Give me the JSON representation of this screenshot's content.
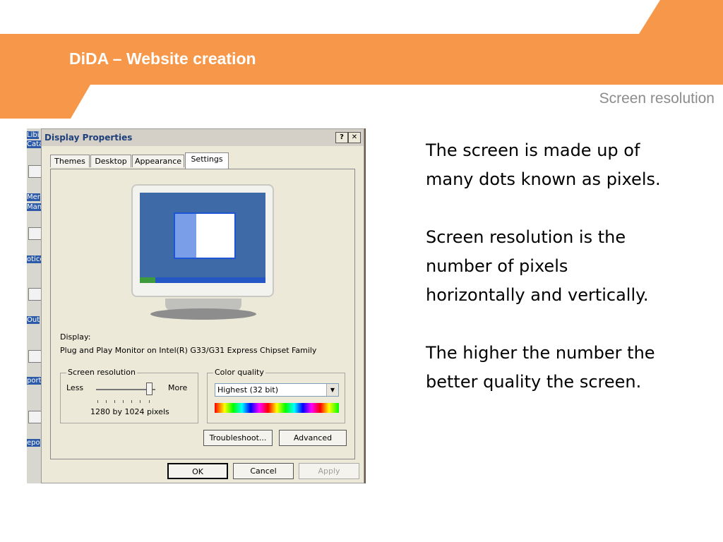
{
  "header": {
    "title": "DiDA – Website creation",
    "subtitle": "Screen resolution",
    "accent_color": "#f7974a"
  },
  "body_text": [
    "The screen is made up of many dots known as pixels.",
    "Screen resolution is the number of pixels horizontally and vertically.",
    "The higher the number the better quality the screen."
  ],
  "desktop": {
    "icon_labels": [
      "Libi",
      "Cata",
      "Mer",
      "Man",
      "otice",
      "Out",
      "port",
      "epo"
    ]
  },
  "dialog": {
    "title": "Display Properties",
    "help_button": "?",
    "close_button": "✕",
    "tabs": [
      "Themes",
      "Desktop",
      "Appearance",
      "Settings"
    ],
    "active_tab": "Settings",
    "display_label": "Display:",
    "display_value": "Plug and Play Monitor on Intel(R) G33/G31 Express Chipset Family",
    "screen_resolution": {
      "legend": "Screen resolution",
      "less_label": "Less",
      "more_label": "More",
      "value_text": "1280 by 1024 pixels"
    },
    "color_quality": {
      "legend": "Color quality",
      "selected": "Highest (32 bit)"
    },
    "buttons": {
      "troubleshoot": "Troubleshoot...",
      "advanced": "Advanced",
      "ok": "OK",
      "cancel": "Cancel",
      "apply": "Apply"
    }
  }
}
